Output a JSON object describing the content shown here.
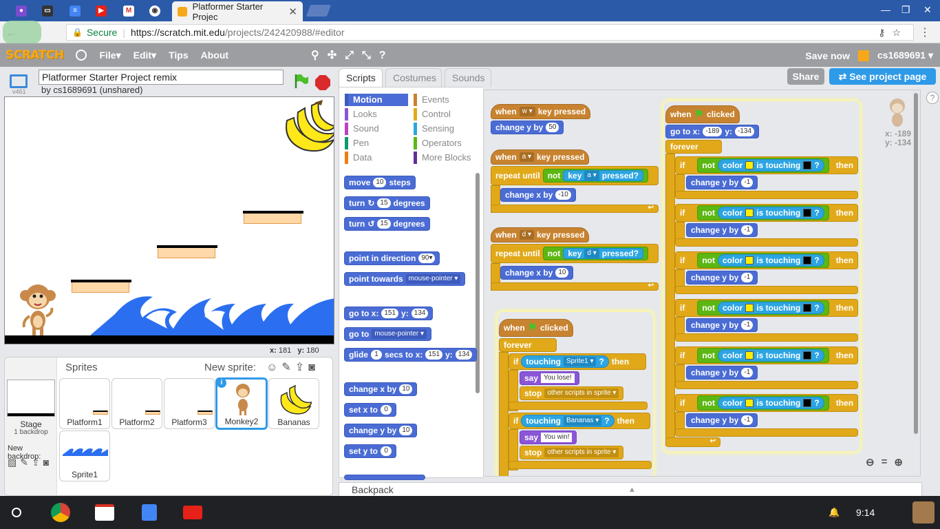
{
  "browser": {
    "tab_title": "Platformer Starter Projec",
    "secure_label": "Secure",
    "url_host": "https://scratch.mit.edu",
    "url_path": "/projects/242420988/#editor",
    "favicon_colors": [
      "#7d4bd1",
      "#444444",
      "#4285f4",
      "#e62117",
      "#d93025",
      "#333333"
    ]
  },
  "menu": {
    "logo": "SCRATCH",
    "file": "File▾",
    "edit": "Edit▾",
    "tips": "Tips",
    "about": "About",
    "save_now": "Save now",
    "username": "cs1689691 ▾"
  },
  "stage_header": {
    "version": "v461",
    "project_title": "Platformer Starter Project remix",
    "byline": "by cs1689691 (unshared)"
  },
  "stage": {
    "coords_x_label": "x:",
    "coords_x": "181",
    "coords_y_label": "y:",
    "coords_y": "180"
  },
  "sprites_pane": {
    "title": "Sprites",
    "new_sprite": "New sprite:",
    "stage_label": "Stage",
    "stage_sub": "1 backdrop",
    "new_backdrop": "New backdrop:",
    "sprites": [
      {
        "name": "Platform1"
      },
      {
        "name": "Platform2"
      },
      {
        "name": "Platform3"
      },
      {
        "name": "Monkey2"
      },
      {
        "name": "Bananas"
      },
      {
        "name": "Sprite1"
      }
    ]
  },
  "tabs": {
    "scripts": "Scripts",
    "costumes": "Costumes",
    "sounds": "Sounds",
    "share": "Share",
    "see_project": "See project page"
  },
  "palette": {
    "categories": [
      {
        "label": "Motion",
        "color": "#4a6cd4"
      },
      {
        "label": "Looks",
        "color": "#8a55d7"
      },
      {
        "label": "Sound",
        "color": "#bb42c3"
      },
      {
        "label": "Pen",
        "color": "#0e9a6c"
      },
      {
        "label": "Data",
        "color": "#ee7d16"
      },
      {
        "label": "Events",
        "color": "#c88330"
      },
      {
        "label": "Control",
        "color": "#e1a91a"
      },
      {
        "label": "Sensing",
        "color": "#2ca5e2"
      },
      {
        "label": "Operators",
        "color": "#5cb712"
      },
      {
        "label": "More Blocks",
        "color": "#632d99"
      }
    ],
    "blocks": {
      "move": "move",
      "move_n": "10",
      "steps": "steps",
      "turn": "turn",
      "turn_n": "15",
      "degrees": "degrees",
      "point_dir": "point in direction",
      "point_dir_n": "90▾",
      "point_towards": "point towards",
      "point_towards_v": "mouse-pointer ▾",
      "goto": "go to x:",
      "goto_x": "151",
      "y": "y:",
      "goto_y": "134",
      "goto_v": "go to",
      "goto_target": "mouse-pointer ▾",
      "glide": "glide",
      "glide_n": "1",
      "secs_to_x": "secs to x:",
      "glide_x": "151",
      "glide_y": "134",
      "change_x": "change x by",
      "change_x_n": "10",
      "set_x": "set x to",
      "set_x_n": "0",
      "change_y": "change y by",
      "change_y_n": "10",
      "set_y": "set y to",
      "set_y_n": "0"
    }
  },
  "scripts": {
    "when": "when",
    "key_pressed": "key pressed",
    "key_w": "w ▾",
    "key_a": "a ▾",
    "key_d": "d ▾",
    "change_y_by": "change y by",
    "change_x_by": "change x by",
    "val_50": "50",
    "val_neg10": "-10",
    "val_10": "10",
    "val_neg1": "-1",
    "repeat_until": "repeat until",
    "not": "not",
    "key": "key",
    "pressed_q": "pressed?",
    "clicked": "clicked",
    "forever": "forever",
    "if": "if",
    "then": "then",
    "touching": "touching",
    "sprite1_opt": "Sprite1 ▾",
    "bananas_opt": "Bananas ▾",
    "q": "?",
    "say": "say",
    "you_lose": "You lose!",
    "you_win": "You win!",
    "stop": "stop",
    "stop_opt": "other scripts in sprite ▾",
    "goto_x": "go to x:",
    "x_val": "-189",
    "y_label": "y:",
    "y_val": "-134",
    "color": "color",
    "is_touching": "is touching",
    "touch_color_a": "#ffee00",
    "touch_color_b": "#000000",
    "corner_x": "x: -189",
    "corner_y": "y: -134"
  },
  "backpack": {
    "label": "Backpack"
  },
  "shelf": {
    "time": "9:14"
  }
}
